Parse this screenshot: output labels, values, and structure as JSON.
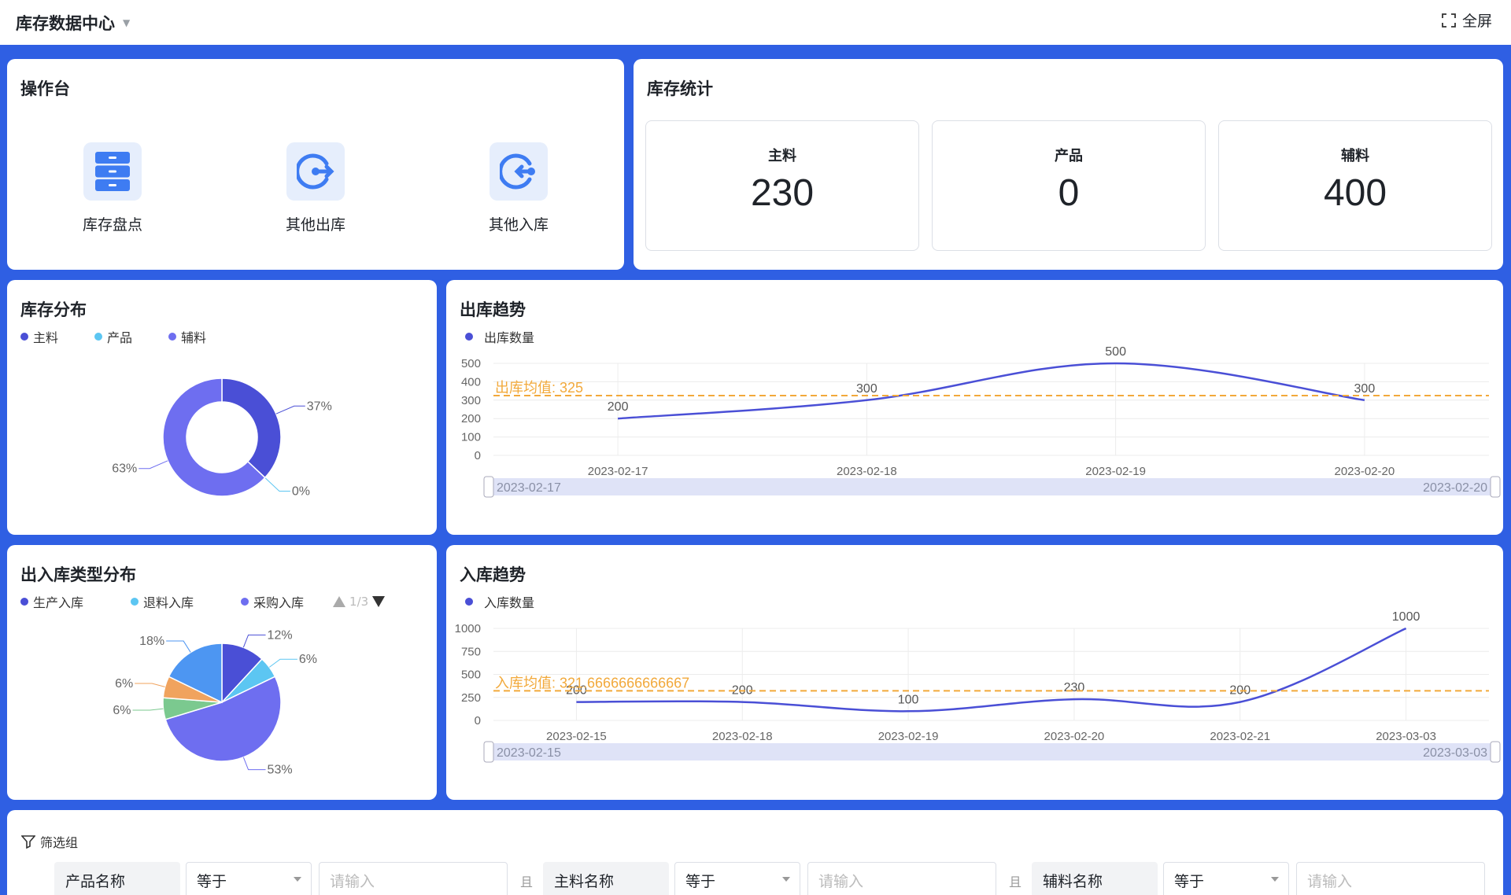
{
  "header": {
    "title": "库存数据中心",
    "fullscreen_label": "全屏"
  },
  "workbench": {
    "title": "操作台",
    "items": [
      {
        "label": "库存盘点",
        "icon": "cabinet-icon"
      },
      {
        "label": "其他出库",
        "icon": "exit-arrow-icon"
      },
      {
        "label": "其他入库",
        "icon": "enter-arrow-icon"
      }
    ]
  },
  "stats": {
    "title": "库存统计",
    "items": [
      {
        "label": "主料",
        "value": "230"
      },
      {
        "label": "产品",
        "value": "0"
      },
      {
        "label": "辅料",
        "value": "400"
      }
    ]
  },
  "distribution": {
    "title": "库存分布",
    "legend": [
      "主料",
      "产品",
      "辅料"
    ],
    "labels": [
      "37%",
      "0%",
      "63%"
    ]
  },
  "outbound": {
    "title": "出库趋势",
    "legend": "出库数量",
    "avg_label": "出库均值: 325",
    "zoom_start": "2023-02-17",
    "zoom_end": "2023-02-20"
  },
  "types": {
    "title": "出入库类型分布",
    "legend": [
      "生产入库",
      "退料入库",
      "采购入库"
    ],
    "pager": "1/3",
    "labels": [
      "12%",
      "6%",
      "53%",
      "6%",
      "6%",
      "18%"
    ]
  },
  "inbound": {
    "title": "入库趋势",
    "legend": "入库数量",
    "avg_label": "入库均值: 321.6666666666667",
    "zoom_start": "2023-02-15",
    "zoom_end": "2023-03-03"
  },
  "filter": {
    "title": "筛选组",
    "and_label": "且",
    "rows": [
      {
        "field": "产品名称",
        "op": "等于",
        "placeholder": "请输入"
      },
      {
        "field": "主料名称",
        "op": "等于",
        "placeholder": "请输入"
      },
      {
        "field": "辅料名称",
        "op": "等于",
        "placeholder": "请输入"
      }
    ]
  },
  "colors": {
    "primary": "#4a4fd6",
    "cyan": "#5cc6f2",
    "violet": "#6e6ef0",
    "avg": "#f2a93b",
    "bg": "#2f5fe3"
  },
  "chart_data": [
    {
      "type": "pie",
      "title": "库存分布",
      "categories": [
        "主料",
        "产品",
        "辅料"
      ],
      "values": [
        37,
        0,
        63
      ],
      "donut": true
    },
    {
      "type": "line",
      "title": "出库趋势",
      "series": [
        {
          "name": "出库数量",
          "values": [
            200,
            300,
            500,
            300
          ]
        }
      ],
      "x": [
        "2023-02-17",
        "2023-02-18",
        "2023-02-19",
        "2023-02-20"
      ],
      "ylim": [
        0,
        500
      ],
      "yticks": [
        0,
        100,
        200,
        300,
        400,
        500
      ],
      "mean": 325
    },
    {
      "type": "pie",
      "title": "出入库类型分布",
      "categories": [
        "生产入库",
        "退料入库",
        "采购入库"
      ],
      "values": [
        12,
        6,
        53,
        6,
        6,
        18
      ]
    },
    {
      "type": "line",
      "title": "入库趋势",
      "series": [
        {
          "name": "入库数量",
          "values": [
            200,
            200,
            100,
            230,
            200,
            1000
          ]
        }
      ],
      "x": [
        "2023-02-15",
        "2023-02-18",
        "2023-02-19",
        "2023-02-20",
        "2023-02-21",
        "2023-03-03"
      ],
      "ylim": [
        0,
        1000
      ],
      "yticks": [
        0,
        250,
        500,
        750,
        1000
      ],
      "mean": 321.6666666666667
    }
  ]
}
